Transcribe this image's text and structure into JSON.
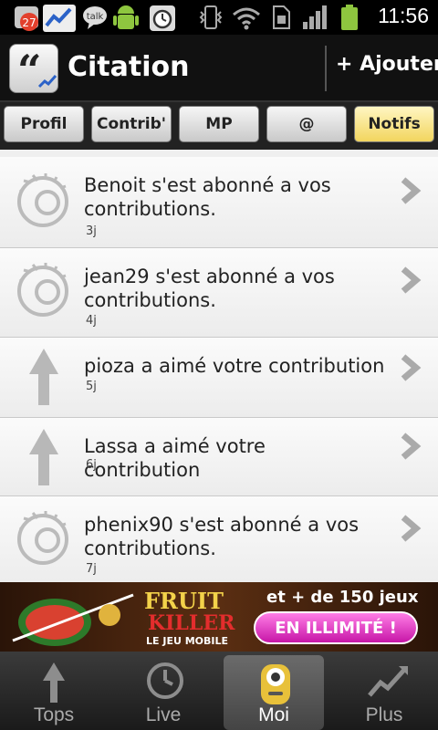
{
  "status_bar": {
    "time": "11:56",
    "notification_count": "27",
    "talk_label": "talk"
  },
  "header": {
    "title": "Citation",
    "add_label": "+ Ajouter"
  },
  "tabs": [
    {
      "label": "Profil",
      "active": false
    },
    {
      "label": "Contrib'",
      "active": false
    },
    {
      "label": "MP",
      "active": false
    },
    {
      "label": "@",
      "active": false
    },
    {
      "label": "Notifs",
      "active": true
    }
  ],
  "notifications": [
    {
      "icon": "avatar-swirl-icon",
      "text": "Benoit s'est abonné a vos contributions.",
      "time": "3j"
    },
    {
      "icon": "avatar-swirl-icon",
      "text": "jean29 s'est abonné a vos contributions.",
      "time": "4j"
    },
    {
      "icon": "up-arrow-icon",
      "text": "pioza a aimé votre contribution",
      "time": "5j"
    },
    {
      "icon": "up-arrow-icon",
      "text": "Lassa a aimé votre contribution",
      "time": "6j"
    },
    {
      "icon": "avatar-swirl-icon",
      "text": "phenix90 s'est abonné a vos contributions.",
      "time": "7j"
    }
  ],
  "ad": {
    "title_line1": "FRUIT",
    "title_line2": "KILLER",
    "subtitle": "LE JEU MOBILE",
    "promo": "et + de 150 jeux",
    "cta": "EN ILLIMITÉ !"
  },
  "bottom_nav": [
    {
      "label": "Tops",
      "icon": "up-arrow-icon",
      "active": false
    },
    {
      "label": "Live",
      "icon": "clock-icon",
      "active": false
    },
    {
      "label": "Moi",
      "icon": "user-face-icon",
      "active": true
    },
    {
      "label": "Plus",
      "icon": "trend-chart-icon",
      "active": false
    }
  ],
  "colors": {
    "active_tab": "#f2d55e",
    "background": "#efefef"
  }
}
